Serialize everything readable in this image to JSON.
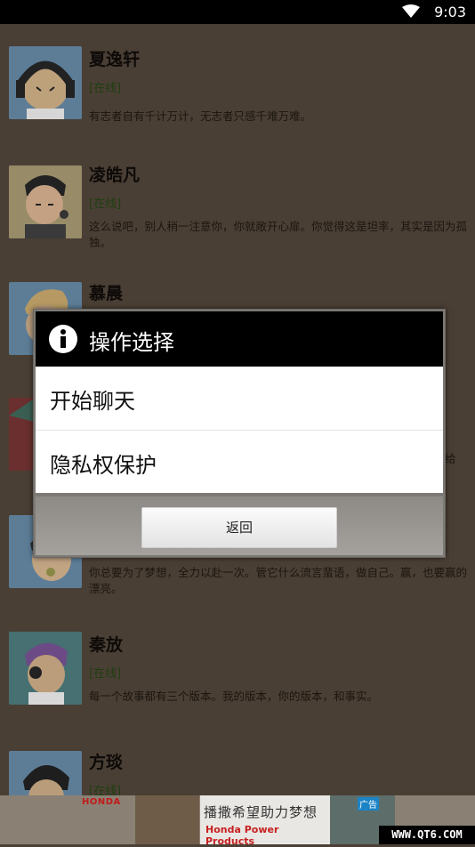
{
  "status_bar": {
    "time": "9:03",
    "wifi_icon": "wifi-icon"
  },
  "contacts": [
    {
      "name": "夏逸轩",
      "status": "[在线]",
      "signature": "有志者自有千计万计，无志者只感千难万难。",
      "avatar_icon": "avatar-headphones"
    },
    {
      "name": "凌皓凡",
      "status": "[在线]",
      "signature": "这么说吧，别人稍一注意你，你就敞开心扉。你觉得这是坦率，其实是因为孤独。",
      "avatar_icon": "avatar-singer"
    },
    {
      "name": "慕晨",
      "status": "",
      "signature": "",
      "avatar_icon": "avatar-blond"
    },
    {
      "name": "",
      "status": "",
      "signature": "",
      "avatar_icon": "avatar-red"
    },
    {
      "name": "",
      "status": "",
      "signature": "你总要为了梦想，全力以赴一次。管它什么流言蜚语，做自己。赢，也要赢的漂亮。",
      "avatar_icon": "avatar-blue"
    },
    {
      "name": "秦放",
      "status": "[在线]",
      "signature": "每一个故事都有三个版本。我的版本，你的版本，和事实。",
      "avatar_icon": "avatar-purple-hair"
    },
    {
      "name": "方琰",
      "status": "[在线]",
      "signature": "",
      "avatar_icon": "avatar-dark-hair"
    }
  ],
  "partial_text": "给",
  "dialog": {
    "title": "操作选择",
    "title_icon": "info-icon",
    "items": [
      "开始聊天",
      "隐私权保护"
    ],
    "back_button": "返回"
  },
  "ad": {
    "honda": "HONDA",
    "slogan_cn": "播撒希望助力梦想",
    "slogan_en": "Honda Power Products",
    "badge": "广告"
  },
  "watermark": "WWW.QT6.COM"
}
